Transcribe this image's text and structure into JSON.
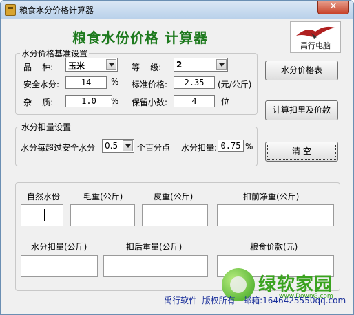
{
  "window": {
    "title": "粮食水分价格计算器",
    "close_label": "✕"
  },
  "header": {
    "title": "粮食水份价格 计算器",
    "logo_text": "禹行电脑"
  },
  "basis": {
    "legend": "水分价格基准设置",
    "variety_label": "品    种:",
    "variety_value": "玉米",
    "grade_label": "等    级:",
    "grade_value": "2",
    "safe_moisture_label": "安全水分:",
    "safe_moisture_value": "14",
    "safe_moisture_unit": "%",
    "std_price_label": "标准价格:",
    "std_price_value": "2.35",
    "std_price_unit": "(元/公斤)",
    "impurity_label": "杂    质:",
    "impurity_value": "1.0",
    "impurity_unit": "%",
    "decimals_label": "保留小数:",
    "decimals_value": "4",
    "decimals_unit": "位"
  },
  "deduction": {
    "legend": "水分扣量设置",
    "over_label": "水分每超过安全水分",
    "over_value": "0.5",
    "over_unit": "个百分点",
    "deduct_label": "水分扣量:",
    "deduct_value": "0.75",
    "deduct_unit": "%"
  },
  "buttons": {
    "table": "水分价格表",
    "calc": "计算扣里及价款",
    "clear": "清    空"
  },
  "results": {
    "natural_moisture": "自然水份",
    "gross_weight": "毛重(公斤)",
    "tare_weight": "皮重(公斤)",
    "pre_net_weight": "扣前净重(公斤)",
    "moisture_deduct": "水分扣量(公斤)",
    "post_weight": "扣后重量(公斤)",
    "grain_price": "粮食价款(元)"
  },
  "footer": {
    "text": "禹行软件  版权所有   邮箱:1646425550qq.com"
  },
  "watermark": {
    "text": "绿软家园",
    "url": "www.DownG.com"
  },
  "colors": {
    "title_green": "#1e7a1e",
    "footer_blue": "#1a2f9a",
    "watermark_green": "#3aa31f"
  }
}
